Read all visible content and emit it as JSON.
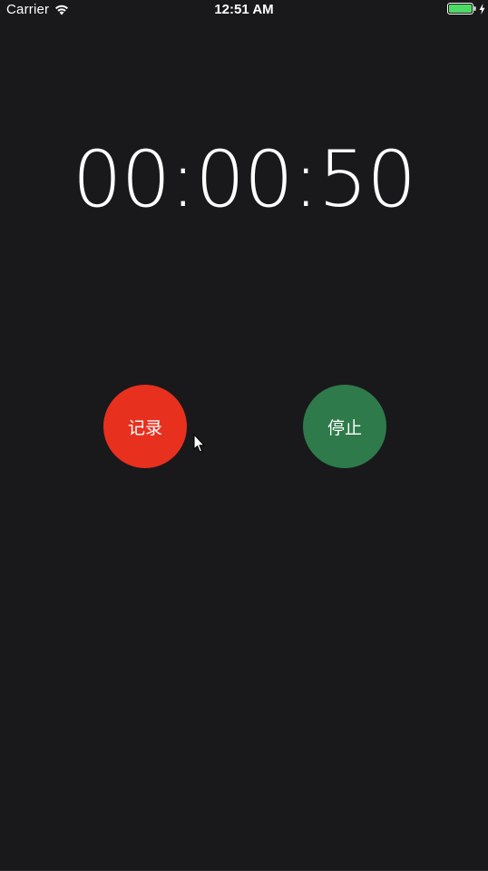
{
  "status_bar": {
    "carrier": "Carrier",
    "time": "12:51 AM",
    "wifi_icon": "wifi-icon",
    "battery_icon": "battery-icon",
    "charging_icon": "charging-bolt-icon",
    "battery_color": "#4cd964"
  },
  "stopwatch": {
    "elapsed": "00:00:50"
  },
  "controls": {
    "record_label": "记录",
    "record_color": "#e8301f",
    "stop_label": "停止",
    "stop_color": "#2e7a4a"
  },
  "colors": {
    "background": "#19191b",
    "text": "#ffffff"
  }
}
